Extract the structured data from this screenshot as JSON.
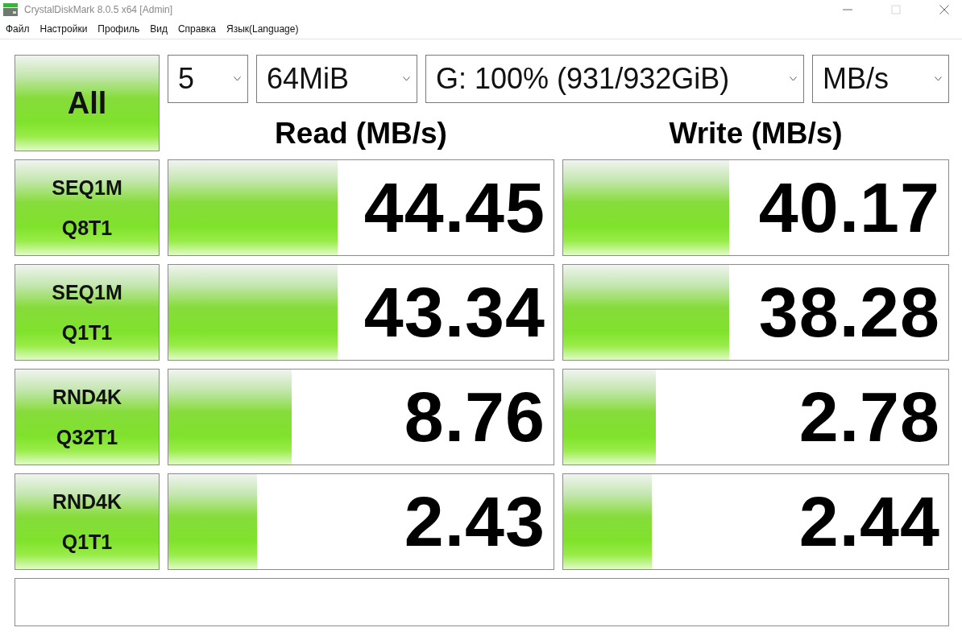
{
  "window": {
    "title": "CrystalDiskMark 8.0.5 x64 [Admin]",
    "controls": [
      {
        "kind": "minimize",
        "disabled": false
      },
      {
        "kind": "maximize",
        "disabled": true
      },
      {
        "kind": "close",
        "disabled": false
      }
    ]
  },
  "menu": [
    "Файл",
    "Настройки",
    "Профиль",
    "Вид",
    "Справка",
    "Язык(Language)"
  ],
  "all_button": "All",
  "selectors": [
    {
      "value": "5"
    },
    {
      "value": "64MiB"
    },
    {
      "value": "G: 100% (931/932GiB)"
    },
    {
      "value": "MB/s"
    }
  ],
  "columns": [
    "Read (MB/s)",
    "Write (MB/s)"
  ],
  "tests": [
    {
      "label": [
        "SEQ1M",
        "Q8T1"
      ],
      "read": {
        "value": "44.45",
        "level": 0.44
      },
      "write": {
        "value": "40.17",
        "level": 0.43
      }
    },
    {
      "label": [
        "SEQ1M",
        "Q1T1"
      ],
      "read": {
        "value": "43.34",
        "level": 0.44
      },
      "write": {
        "value": "38.28",
        "level": 0.43
      }
    },
    {
      "label": [
        "RND4K",
        "Q32T1"
      ],
      "read": {
        "value": "8.76",
        "level": 0.32
      },
      "write": {
        "value": "2.78",
        "level": 0.24
      }
    },
    {
      "label": [
        "RND4K",
        "Q1T1"
      ],
      "read": {
        "value": "2.43",
        "level": 0.23
      },
      "write": {
        "value": "2.44",
        "level": 0.23
      }
    }
  ]
}
